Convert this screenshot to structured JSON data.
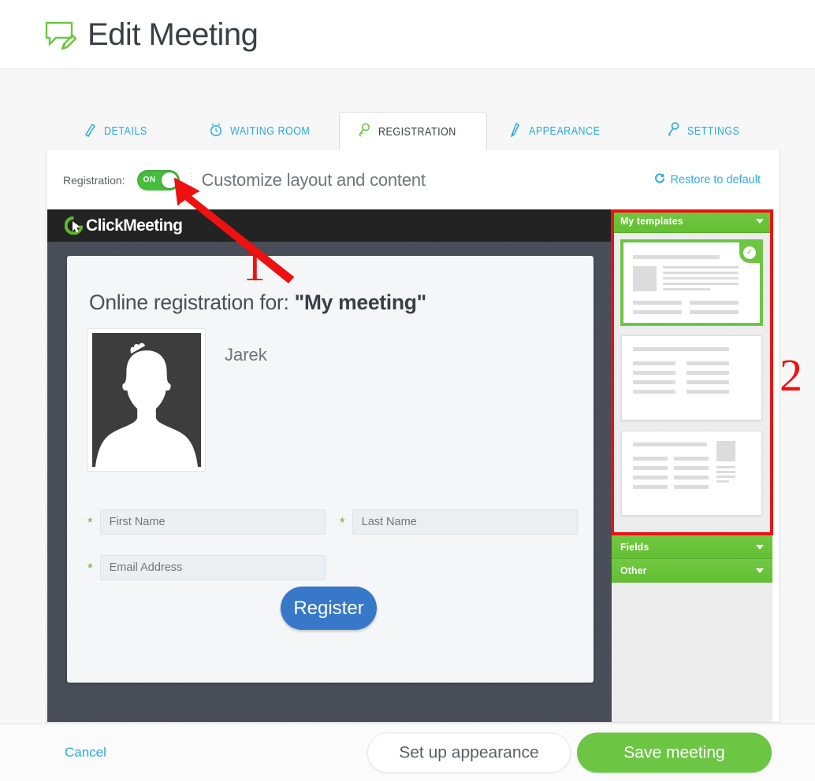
{
  "header": {
    "title": "Edit Meeting",
    "icon": "edit-speech-bubble-icon"
  },
  "tabs": [
    {
      "label": "DETAILS",
      "icon": "pencil-icon",
      "active": false
    },
    {
      "label": "WAITING ROOM",
      "icon": "alarm-clock-icon",
      "active": false
    },
    {
      "label": "REGISTRATION",
      "icon": "key-icon",
      "active": true
    },
    {
      "label": "APPEARANCE",
      "icon": "paintbrush-icon",
      "active": false
    },
    {
      "label": "SETTINGS",
      "icon": "wrench-icon",
      "active": false
    }
  ],
  "toolbar": {
    "registration_label": "Registration:",
    "toggle_state": "ON",
    "customize_text": "Customize layout and content",
    "restore_label": "Restore to default",
    "restore_icon": "refresh-circle-icon"
  },
  "preview": {
    "brand": "ClickMeeting",
    "brand_icon": "clickmeeting-cursor-logo",
    "heading_prefix": "Online registration for: ",
    "heading_meeting": "\"My meeting\"",
    "organizer_name": "Jarek",
    "avatar_icon": "default-person-avatar",
    "fields": [
      {
        "name": "first-name",
        "placeholder": "First Name",
        "required": true,
        "value": ""
      },
      {
        "name": "last-name",
        "placeholder": "Last Name",
        "required": true,
        "value": ""
      },
      {
        "name": "email",
        "placeholder": "Email Address",
        "required": true,
        "value": ""
      }
    ],
    "required_marker": "*",
    "register_button": "Register"
  },
  "sidebar": {
    "sections": [
      {
        "key": "my-templates",
        "label": "My templates",
        "expanded": true
      },
      {
        "key": "fields",
        "label": "Fields",
        "expanded": false
      },
      {
        "key": "other",
        "label": "Other",
        "expanded": false
      }
    ],
    "templates": [
      {
        "id": "template-1",
        "layout": "avatar-left-two-column",
        "selected": true,
        "badge": "check-icon"
      },
      {
        "id": "template-2",
        "layout": "two-column-no-avatar",
        "selected": false,
        "badge": ""
      },
      {
        "id": "template-3",
        "layout": "avatar-right-two-column",
        "selected": false,
        "badge": ""
      }
    ]
  },
  "footer": {
    "cancel": "Cancel",
    "setup_appearance": "Set up appearance",
    "save_meeting": "Save meeting"
  },
  "annotations": [
    {
      "id": "1",
      "label": "1",
      "target": "registration-toggle"
    },
    {
      "id": "2",
      "label": "2",
      "target": "my-templates-panel"
    }
  ],
  "colors": {
    "accent_blue": "#29abe2",
    "accent_green": "#6cc644",
    "toggle_green": "#46bd3e",
    "register_blue": "#3778c8",
    "annotation_red": "#ee1111",
    "preview_dark": "#474c57",
    "brand_bar": "#232323"
  }
}
